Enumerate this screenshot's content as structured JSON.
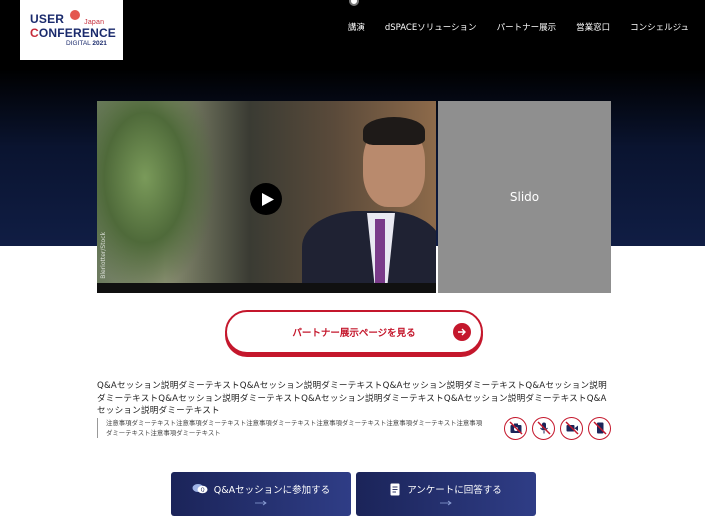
{
  "header": {
    "logo": {
      "line1": "USER",
      "line1_suffix": "Japan",
      "line2_prefix": "C",
      "line2_rest": "ONFERENCE",
      "line3_text": "DIGITAL",
      "line3_year": "2021"
    },
    "nav": [
      "講演",
      "dSPACEソリューション",
      "パートナー展示",
      "営業窓口",
      "コンシェルジュ"
    ]
  },
  "video": {
    "side_mark": "Bleriotter/Stock",
    "play_icon": "play-icon"
  },
  "slido": {
    "label": "Slido"
  },
  "partner_button": {
    "label": "パートナー展示ページを見る"
  },
  "description": "Q&Aセッション説明ダミーテキストQ&Aセッション説明ダミーテキストQ&Aセッション説明ダミーテキストQ&Aセッション説明ダミーテキストQ&Aセッション説明ダミーテキストQ&Aセッション説明ダミーテキストQ&Aセッション説明ダミーテキストQ&Aセッション説明ダミーテキスト",
  "notes": "注意事項ダミーテキスト注意事項ダミーテキスト注意事項ダミーテキスト注意事項ダミーテキスト注意事項ダミーテキスト注意事項ダミーテキスト注意事項ダミーテキスト",
  "notice_icons": [
    "no-photo-icon",
    "no-audio-recording-icon",
    "no-video-recording-icon",
    "no-phone-icon"
  ],
  "ctas": {
    "qa": {
      "label": "Q&Aセッションに参加する",
      "icon": "chat-bubbles-icon"
    },
    "survey": {
      "label": "アンケートに回答する",
      "icon": "document-icon"
    }
  },
  "colors": {
    "accent_red": "#c4172c",
    "navy": "#1b2459",
    "slido_gray": "#8f8f8f"
  }
}
